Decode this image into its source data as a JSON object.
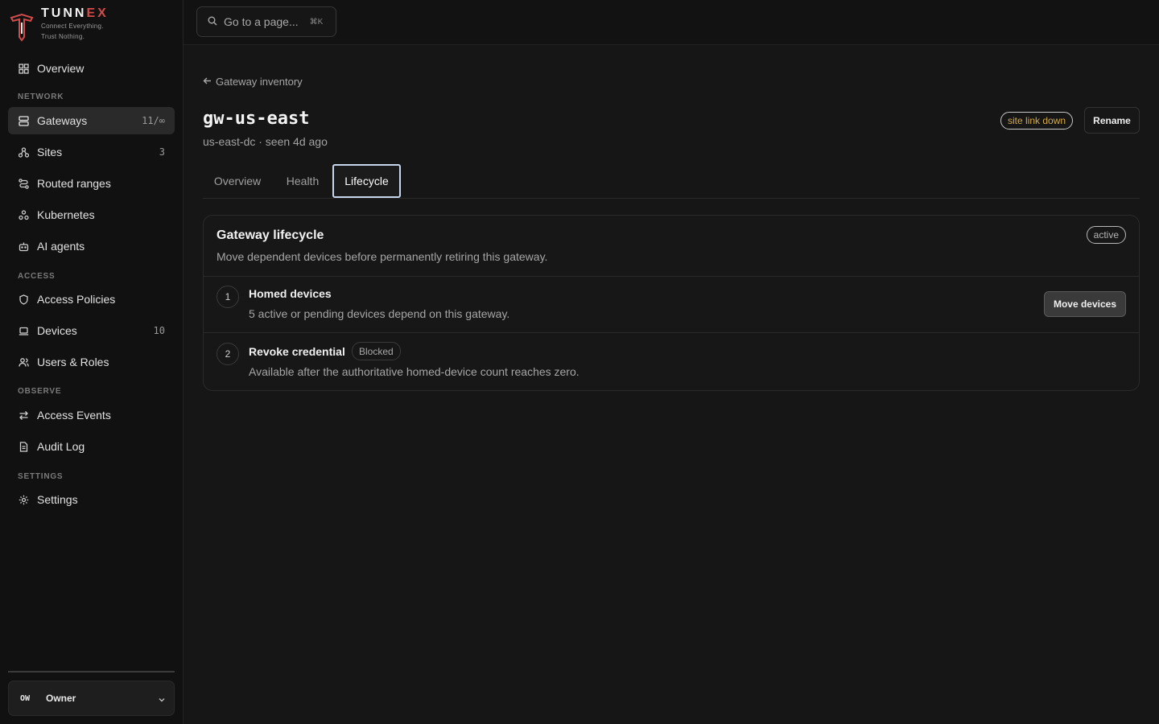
{
  "brand": {
    "name_main": "TUNN",
    "name_accent": "EX",
    "tagline_line1": "Connect Everything.",
    "tagline_line2": "Trust Nothing."
  },
  "sidebar": {
    "overview": {
      "label": "Overview",
      "icon": "grid-icon"
    },
    "sections": {
      "network": "NETWORK",
      "access": "ACCESS",
      "observe": "OBSERVE",
      "settings": "SETTINGS"
    },
    "items": {
      "gateways": {
        "label": "Gateways",
        "count": "11/∞",
        "icon": "server-icon"
      },
      "sites": {
        "label": "Sites",
        "count": "3",
        "icon": "sites-icon"
      },
      "routed_ranges": {
        "label": "Routed ranges",
        "icon": "routes-icon"
      },
      "kubernetes": {
        "label": "Kubernetes",
        "icon": "kubernetes-icon"
      },
      "ai_agents": {
        "label": "AI agents",
        "icon": "bot-icon"
      },
      "access_policies": {
        "label": "Access Policies",
        "icon": "shield-icon"
      },
      "devices": {
        "label": "Devices",
        "count": "10",
        "icon": "laptop-icon"
      },
      "users_roles": {
        "label": "Users & Roles",
        "icon": "users-icon"
      },
      "access_events": {
        "label": "Access Events",
        "icon": "arrows-swap-icon"
      },
      "audit_log": {
        "label": "Audit Log",
        "icon": "document-icon"
      },
      "settings": {
        "label": "Settings",
        "icon": "gear-icon"
      }
    },
    "owner": {
      "initials": "OW",
      "name": "Owner"
    }
  },
  "topbar": {
    "search_placeholder": "Go to a page...",
    "search_shortcut": "⌘K"
  },
  "page": {
    "back_label": "Gateway inventory",
    "title": "gw-us-east",
    "subtitle": "us-east-dc · seen 4d ago",
    "status_badge": "site link down",
    "status_color": "#d4a94a",
    "rename_label": "Rename",
    "tabs": [
      "Overview",
      "Health",
      "Lifecycle"
    ],
    "active_tab": "Lifecycle"
  },
  "lifecycle": {
    "title": "Gateway lifecycle",
    "description": "Move dependent devices before permanently retiring this gateway.",
    "state": "active",
    "steps": [
      {
        "number": "1",
        "title": "Homed devices",
        "description": "5 active or pending devices depend on this gateway.",
        "action": "Move devices"
      },
      {
        "number": "2",
        "title": "Revoke credential",
        "badge": "Blocked",
        "description": "Available after the authoritative homed-device count reaches zero."
      }
    ]
  }
}
